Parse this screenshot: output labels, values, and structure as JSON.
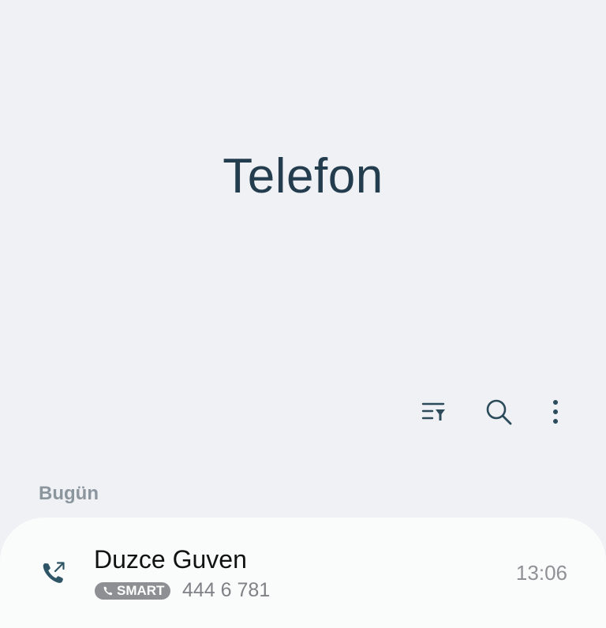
{
  "header": {
    "title": "Telefon"
  },
  "toolbar": {
    "icons": [
      "filter-icon",
      "search-icon",
      "more-options-icon"
    ]
  },
  "colors": {
    "background": "#eff1f4",
    "title": "#233d4f",
    "accent_icon": "#2d5566",
    "badge": "#8d8f92"
  },
  "call_log": {
    "section_label": "Bugün",
    "entries": [
      {
        "name": "Duzce Guven",
        "badge": "SMART",
        "number": "444 6 781",
        "time": "13:06",
        "call_icon": "outgoing-call-icon"
      }
    ]
  }
}
